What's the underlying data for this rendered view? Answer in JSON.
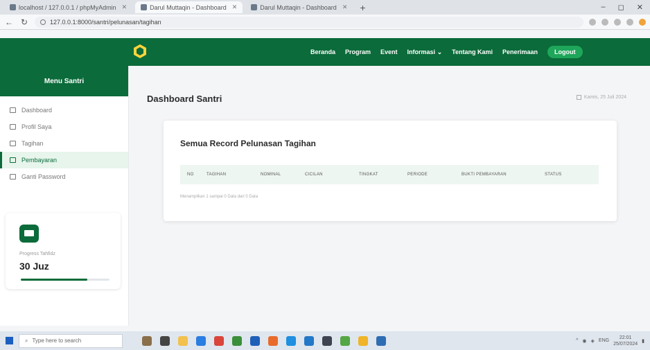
{
  "browser": {
    "tabs": [
      {
        "label": "localhost / 127.0.0.1 / phpMyAdmin"
      },
      {
        "label": "Darul Muttaqin - Dashboard"
      },
      {
        "label": "Darul Muttaqin - Dashboard"
      }
    ],
    "url": "127.0.0.1:8000/santri/pelunasan/tagihan"
  },
  "navbar": {
    "items": [
      "Beranda",
      "Program",
      "Event",
      "Informasi",
      "Tentang Kami",
      "Penerimaan"
    ],
    "informasi_caret": "⌄",
    "logout": "Logout"
  },
  "sidebar": {
    "title": "Menu Santri",
    "items": [
      {
        "label": "Dashboard",
        "icon": "grid-icon"
      },
      {
        "label": "Profil Saya",
        "icon": "user-icon"
      },
      {
        "label": "Tagihan",
        "icon": "dollar-icon"
      },
      {
        "label": "Pembayaran",
        "icon": "card-icon",
        "active": true
      },
      {
        "label": "Ganti Password",
        "icon": "lock-icon"
      }
    ],
    "progress": {
      "label": "Progress Tahfidz",
      "value": "30 Juz",
      "fill_percent": 75
    }
  },
  "main": {
    "title": "Dashboard Santri",
    "date": "Kamis, 25 Juli 2024",
    "card": {
      "title": "Semua Record Pelunasan Tagihan",
      "columns": [
        "NO",
        "TAGIHAN",
        "NOMINAL",
        "CICILAN",
        "TINGKAT",
        "PERIODE",
        "BUKTI PEMBAYARAN",
        "STATUS"
      ],
      "info": "Menampilkan 1 sampai 0 Data dari 0 Data"
    }
  },
  "taskbar": {
    "search_placeholder": "Type here to search",
    "time": "22:01",
    "date": "25/07/2024",
    "lang": "ENG"
  },
  "colors": {
    "brand_green": "#0b6b3a",
    "button_green": "#1ea65a",
    "active_row_bg": "#e7f5ec"
  }
}
